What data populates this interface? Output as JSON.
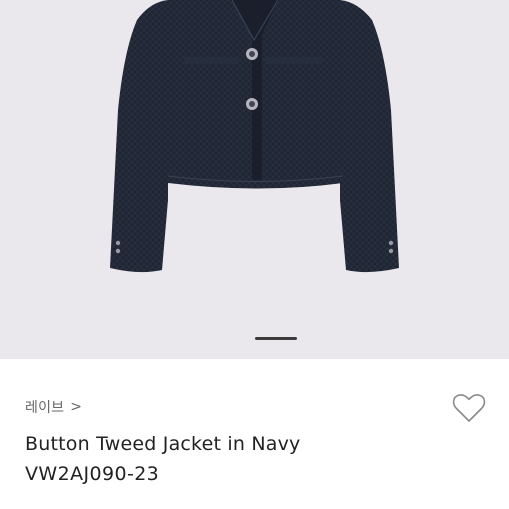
{
  "product": {
    "brand": "레이브",
    "brand_chevron": ">",
    "title": "Button Tweed Jacket in Navy",
    "code": "VW2AJ090-23",
    "image": "navy tweed cropped jacket",
    "wishlist_icon": "heart-outline-icon"
  },
  "gallery": {
    "active_page_indicator": true
  },
  "colors": {
    "background": "#eae8ec",
    "jacket": "#1e2431",
    "text": "#222222",
    "muted": "#666666"
  }
}
